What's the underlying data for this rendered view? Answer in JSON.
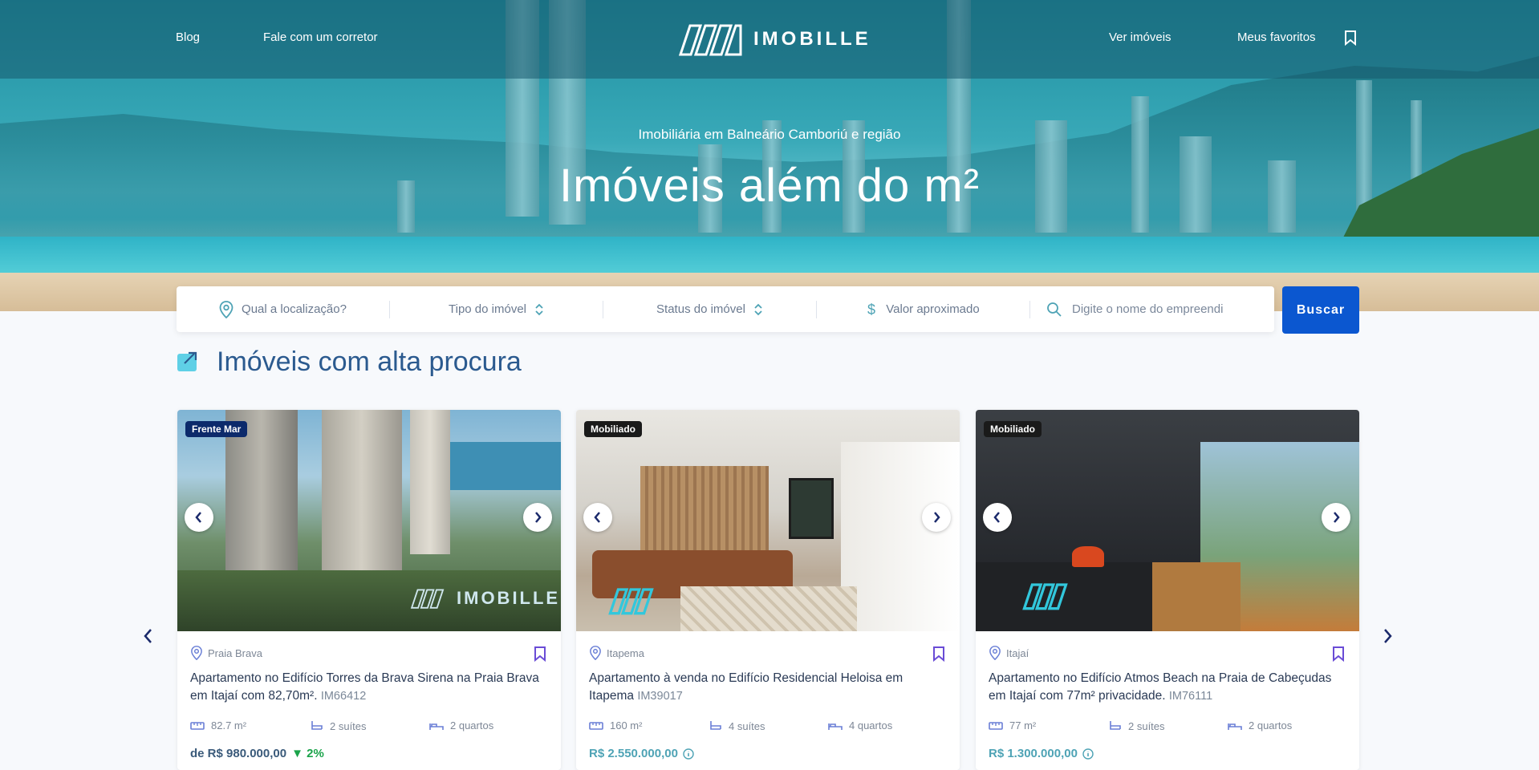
{
  "nav": {
    "blog": "Blog",
    "contact": "Fale com um corretor",
    "logo_text": "IMOBILLE",
    "see_properties": "Ver imóveis",
    "favorites": "Meus favoritos"
  },
  "hero": {
    "subtitle": "Imobiliária em Balneário Camboriú e região",
    "title": "Imóveis além do m²"
  },
  "search": {
    "location_placeholder": "Qual a localização?",
    "type_label": "Tipo do imóvel",
    "status_label": "Status do imóvel",
    "value_label": "Valor aproximado",
    "name_placeholder": "Digite o nome do empreendi",
    "button": "Buscar"
  },
  "section": {
    "title": "Imóveis com alta procura"
  },
  "cards": [
    {
      "badge": "Frente Mar",
      "location": "Praia Brava",
      "title": "Apartamento no Edifício Torres da Brava Sirena na Praia Brava em Itajaí com 82,70m².",
      "code": "IM66412",
      "area": "82.7 m²",
      "suites": "2 suítes",
      "rooms": "2 quartos",
      "price": "de R$ 980.000,00",
      "discount": "▼ 2%",
      "watermark": "IMOBILLE"
    },
    {
      "badge": "Mobiliado",
      "location": "Itapema",
      "title": "Apartamento à venda no Edifício Residencial Heloisa em Itapema",
      "code": "IM39017",
      "area": "160 m²",
      "suites": "4 suítes",
      "rooms": "4 quartos",
      "price": "R$ 2.550.000,00"
    },
    {
      "badge": "Mobiliado",
      "location": "Itajaí",
      "title": "Apartamento no Edifício Atmos Beach na Praia de Cabeçudas em Itajaí com 77m² privacidade.",
      "code": "IM76111",
      "area": "77 m²",
      "suites": "2 suítes",
      "rooms": "2 quartos",
      "price": "R$ 1.300.000,00"
    }
  ],
  "colors": {
    "primary_button": "#0b57d0",
    "accent_teal": "#4ea3b5",
    "title_blue": "#2b5a8f",
    "badge_navy": "#0c2a6b",
    "badge_dark": "#1a1a1a",
    "bookmark": "#6a4cd6",
    "discount_green": "#1aa34a"
  },
  "icons": [
    "location-pin-icon",
    "sort-icon",
    "dollar-icon",
    "search-icon",
    "bookmark-icon",
    "trending-up-icon",
    "area-icon",
    "bathtub-icon",
    "bed-icon",
    "info-icon",
    "chevron-left-icon",
    "chevron-right-icon"
  ]
}
